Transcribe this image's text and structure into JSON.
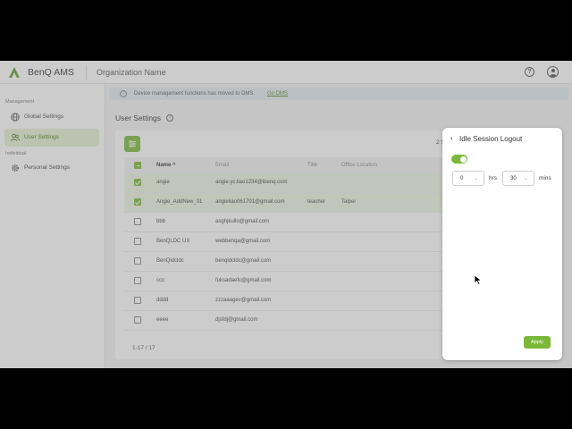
{
  "app": {
    "brand": "BenQ AMS",
    "org_name": "Organization Name",
    "help_icon_glyph": "?",
    "accent": "#7bb83a"
  },
  "sidebar": {
    "management_label": "Management",
    "individual_label": "Individual",
    "items": [
      {
        "label": "Global Settings",
        "icon": "globe-icon"
      },
      {
        "label": "User Settings",
        "icon": "users-icon",
        "active": true
      },
      {
        "label": "Personal Settings",
        "icon": "gear-icon"
      }
    ]
  },
  "notice": {
    "message": "Device management functions has moved to DMS.",
    "link": "Go DMS"
  },
  "page": {
    "title": "User Settings",
    "selected_count": "2 S"
  },
  "table": {
    "headers": {
      "name": "Name",
      "email": "Email",
      "title": "Title",
      "office": "Office Location"
    },
    "rows": [
      {
        "name": "angie",
        "email": "angie.yc.liao1234@ibenq.com",
        "title": "",
        "office": "",
        "checked": true
      },
      {
        "name": "Angie_AddNew_01",
        "email": "angieliao061701@gmail.com",
        "title": "teacher",
        "office": "Taipei",
        "checked": true
      },
      {
        "name": "bbb",
        "email": "asghjkullo@gmail.com",
        "title": "",
        "office": "",
        "checked": false
      },
      {
        "name": "BenQLDC UX",
        "email": "webbenqa@gmail.com",
        "title": "",
        "office": "",
        "checked": false
      },
      {
        "name": "BenQldcldc",
        "email": "benqldcldc@gmail.com",
        "title": "",
        "office": "",
        "checked": false
      },
      {
        "name": "ccc",
        "email": "fuksadaefc@gmail.com",
        "title": "",
        "office": "",
        "checked": false
      },
      {
        "name": "dddd",
        "email": "zzzaaagev@gmail.com",
        "title": "",
        "office": "",
        "checked": false
      },
      {
        "name": "eeee",
        "email": "djsfdj@gmail.com",
        "title": "",
        "office": "",
        "checked": false
      }
    ],
    "pagination": "1-17 / 17"
  },
  "panel": {
    "title": "Idle Session Logout",
    "toggle_on": true,
    "hours_value": "0",
    "hours_unit": "hrs",
    "minutes_value": "30",
    "minutes_unit": "mins",
    "apply_label": "Apply"
  }
}
